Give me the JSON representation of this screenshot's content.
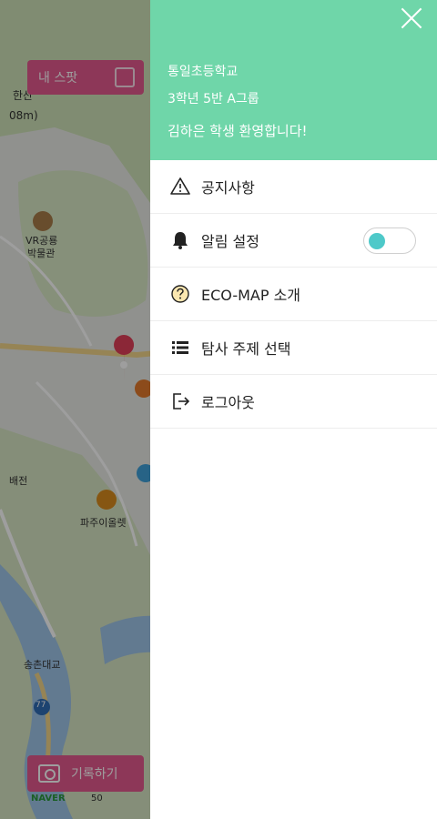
{
  "map": {
    "labels": {
      "mountain": "한산",
      "elevation": "08m)",
      "museum_line1": "VR공룡",
      "museum_line2": "박물관",
      "village": "파주이올렛",
      "bridge": "송촌대교",
      "left_mid": "배전",
      "route_number": "77"
    },
    "my_spot_label": "내 스팟",
    "record_button_label": "기록하기",
    "map_logo": "NAVER",
    "scale_text": "50"
  },
  "drawer": {
    "school_name": "통일초등학교",
    "class_group": "3학년 5반 A그룹",
    "welcome": "김하은 학생 환영합니다!",
    "menu": [
      {
        "label": "공지사항",
        "icon": "warning-triangle-icon"
      },
      {
        "label": "알림 설정",
        "icon": "bell-icon"
      },
      {
        "label": "ECO-MAP 소개",
        "icon": "question-circle-icon"
      },
      {
        "label": "탐사 주제 선택",
        "icon": "list-icon"
      },
      {
        "label": "로그아웃",
        "icon": "logout-icon"
      }
    ],
    "notification_toggle_on": false
  },
  "colors": {
    "header_bg": "#6fd6a9",
    "accent_pink": "#e45a8e",
    "toggle_knob": "#4ec9c9"
  }
}
